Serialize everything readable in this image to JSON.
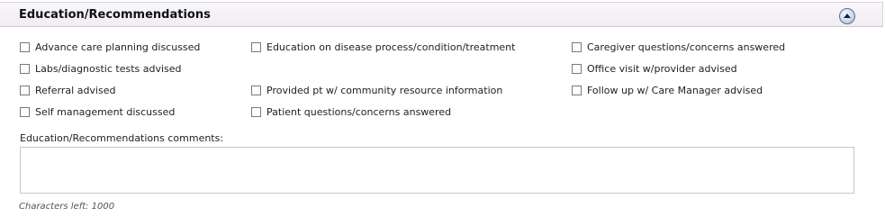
{
  "section": {
    "title": "Education/Recommendations"
  },
  "checkboxes": {
    "advance_care": "Advance care planning discussed",
    "education_disease": "Education on disease process/condition/treatment",
    "caregiver_questions": "Caregiver questions/concerns answered",
    "labs_tests": "Labs/diagnostic tests advised",
    "office_visit": "Office visit w/provider advised",
    "referral": "Referral advised",
    "community_resource": "Provided pt w/ community resource information",
    "follow_up": "Follow up w/ Care Manager advised",
    "self_management": "Self management discussed",
    "patient_questions": "Patient questions/concerns answered"
  },
  "comments": {
    "label": "Education/Recommendations comments:",
    "value": "",
    "chars_left": "Characters left: 1000"
  }
}
